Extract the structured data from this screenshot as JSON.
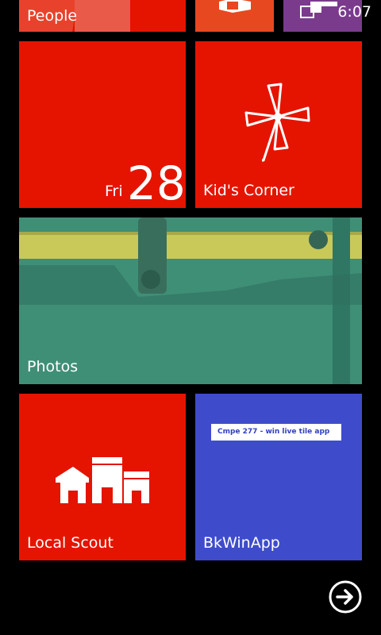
{
  "status_bar": {
    "time": "6:07"
  },
  "tiles": {
    "people": {
      "label": "People",
      "icon": "people-photos-collage"
    },
    "office": {
      "icon": "office-icon"
    },
    "store": {
      "icon": "store-icon"
    },
    "calendar": {
      "day": "Fri",
      "date": "28"
    },
    "kids_corner": {
      "label": "Kid's Corner",
      "icon": "pinwheel-icon"
    },
    "photos": {
      "label": "Photos"
    },
    "local_scout": {
      "label": "Local Scout",
      "icon": "buildings-icon"
    },
    "bkwinapp": {
      "label": "BkWinApp",
      "note": "Cmpe 277 - win live tile app"
    }
  },
  "navigation": {
    "all_apps_icon": "arrow-right-circle-icon"
  },
  "colors": {
    "accent_red": "#e51400",
    "tile_blue": "#3e4ccc",
    "tile_orange": "#e8481f",
    "tile_purple": "#7a3b8c"
  }
}
